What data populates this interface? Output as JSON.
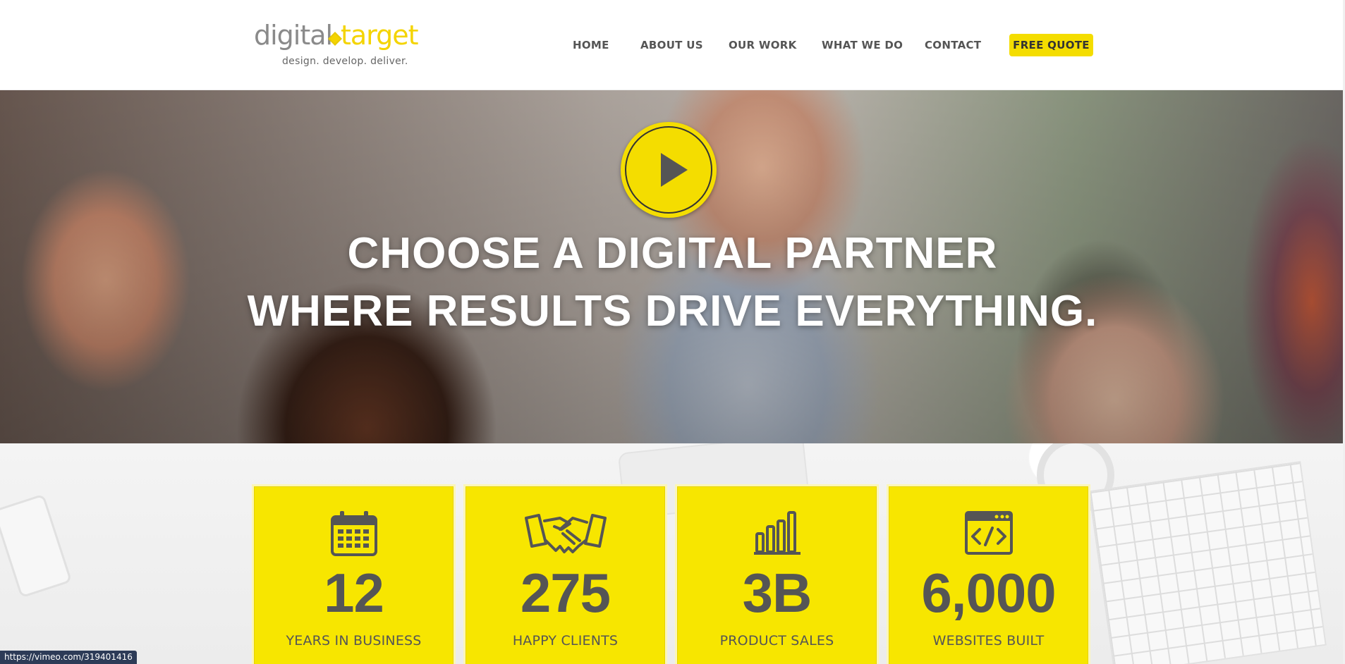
{
  "logo": {
    "word1": "digital",
    "word2": "target",
    "tagline": "design. develop. deliver."
  },
  "nav": {
    "items": [
      "HOME",
      "ABOUT US",
      "OUR WORK",
      "WHAT WE DO",
      "CONTACT"
    ],
    "cta": "FREE QUOTE"
  },
  "hero": {
    "line1": "CHOOSE A DIGITAL PARTNER",
    "line2": "WHERE RESULTS DRIVE EVERYTHING.",
    "play_icon": "play-icon"
  },
  "stats": [
    {
      "icon": "calendar-icon",
      "value": "12",
      "label": "YEARS IN BUSINESS"
    },
    {
      "icon": "handshake-icon",
      "value": "275",
      "label": "HAPPY CLIENTS"
    },
    {
      "icon": "bar-chart-icon",
      "value": "3B",
      "label": "PRODUCT SALES"
    },
    {
      "icon": "code-window-icon",
      "value": "6,000",
      "label": "WEBSITES BUILT"
    }
  ],
  "status_bar": {
    "url": "https://vimeo.com/319401416"
  },
  "colors": {
    "accent": "#f4dd00",
    "card": "#f7e600",
    "text_dark": "#555555"
  }
}
